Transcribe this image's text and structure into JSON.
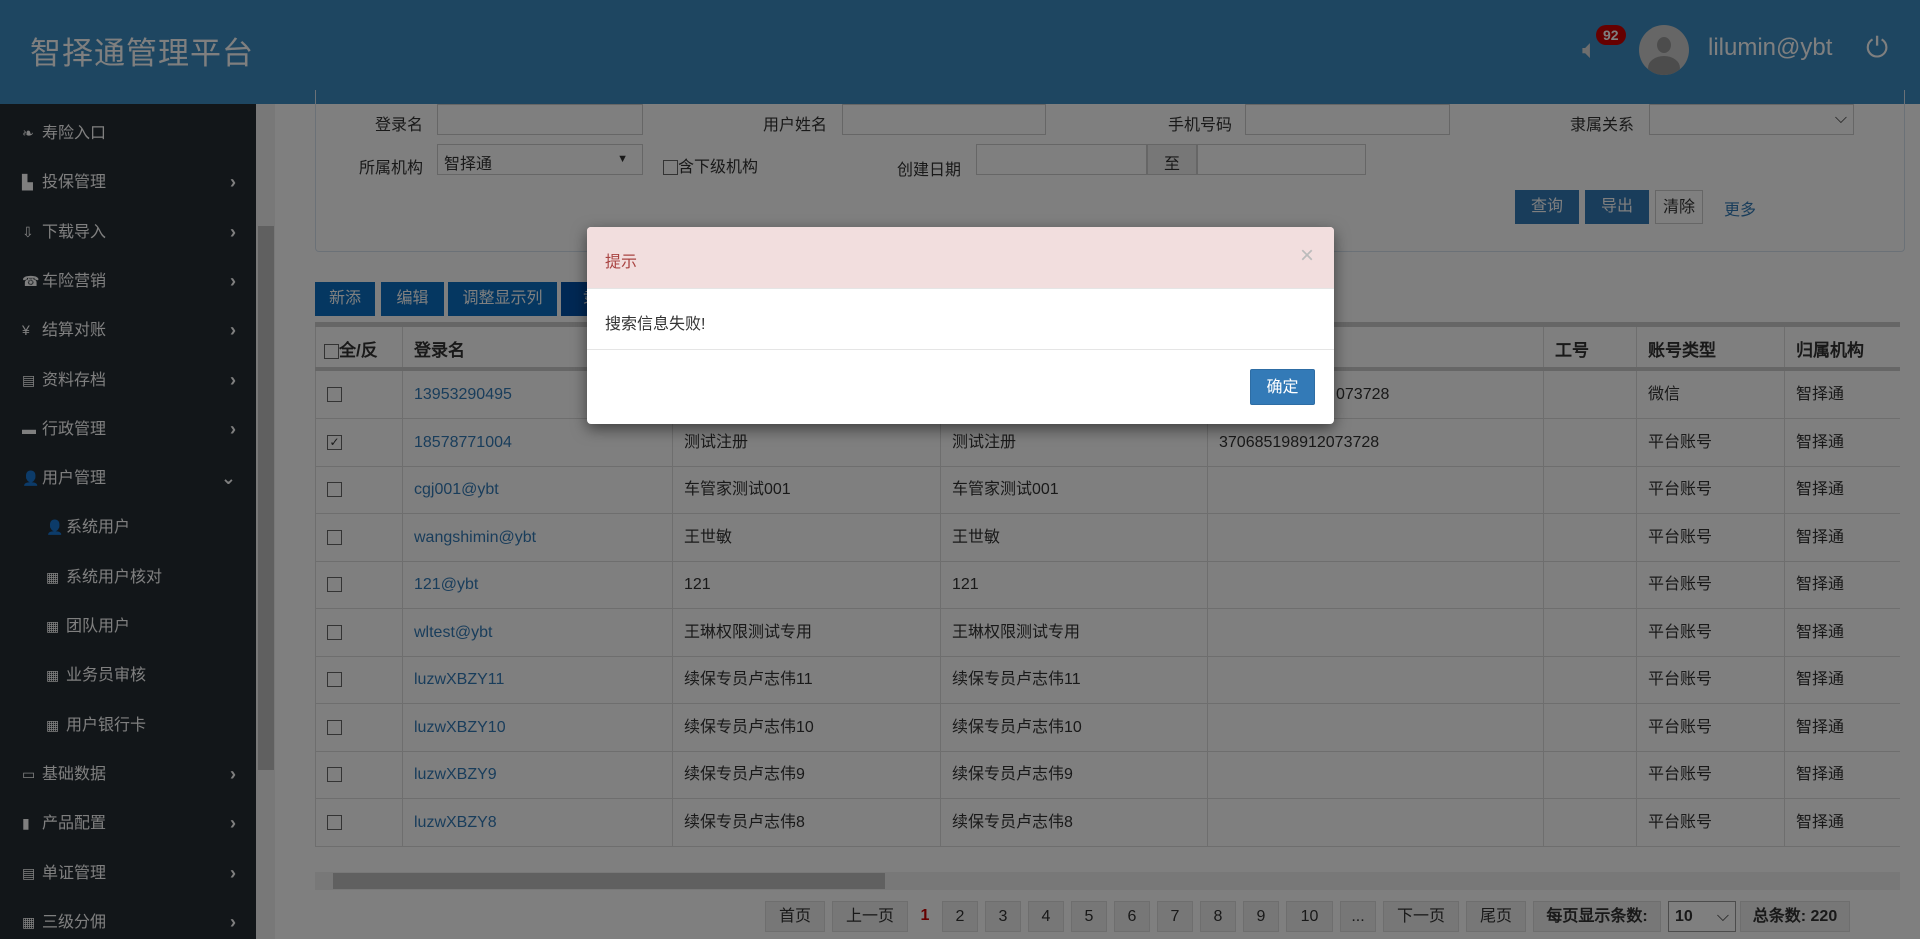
{
  "header": {
    "title": "智择通管理平台",
    "badge": "92",
    "username": "lilumin@ybt"
  },
  "sidebar": {
    "items": [
      {
        "label": "寿险入口",
        "icon": "leaf-icon",
        "glyph": "❧",
        "chevron": ""
      },
      {
        "label": "投保管理",
        "icon": "file-icon",
        "glyph": "▙",
        "chevron": "›"
      },
      {
        "label": "下载导入",
        "icon": "import-icon",
        "glyph": "⇩",
        "chevron": "›"
      },
      {
        "label": "车险营销",
        "icon": "phone-icon",
        "glyph": "☎",
        "chevron": "›"
      },
      {
        "label": "结算对账",
        "icon": "yen-icon",
        "glyph": "¥",
        "chevron": "›"
      },
      {
        "label": "资料存档",
        "icon": "list-icon",
        "glyph": "▤",
        "chevron": "›"
      },
      {
        "label": "行政管理",
        "icon": "folder-icon",
        "glyph": "▬",
        "chevron": "›"
      },
      {
        "label": "用户管理",
        "icon": "user-icon",
        "glyph": "👤",
        "chevron": "⌄"
      },
      {
        "label": "系统用户",
        "icon": "user-icon",
        "glyph": "👤",
        "chevron": "",
        "sub": true
      },
      {
        "label": "系统用户核对",
        "icon": "grid-icon",
        "glyph": "▦",
        "chevron": "",
        "sub": true
      },
      {
        "label": "团队用户",
        "icon": "grid-icon",
        "glyph": "▦",
        "chevron": "",
        "sub": true
      },
      {
        "label": "业务员审核",
        "icon": "grid-icon",
        "glyph": "▦",
        "chevron": "",
        "sub": true
      },
      {
        "label": "用户银行卡",
        "icon": "grid-icon",
        "glyph": "▦",
        "chevron": "",
        "sub": true
      },
      {
        "label": "基础数据",
        "icon": "hdd-icon",
        "glyph": "▭",
        "chevron": "›"
      },
      {
        "label": "产品配置",
        "icon": "book-icon",
        "glyph": "▮",
        "chevron": "›"
      },
      {
        "label": "单证管理",
        "icon": "list-icon",
        "glyph": "▤",
        "chevron": "›"
      },
      {
        "label": "三级分佣",
        "icon": "grid-icon",
        "glyph": "▦",
        "chevron": "›"
      }
    ]
  },
  "search": {
    "login_label": "登录名",
    "name_label": "用户姓名",
    "phone_label": "手机号码",
    "relation_label": "隶属关系",
    "org_label": "所属机构",
    "org_value": "智择通",
    "sub_org_label": "含下级机构",
    "date_label": "创建日期",
    "date_sep": "至",
    "query": "查询",
    "export": "导出",
    "clear": "清除",
    "more": "更多"
  },
  "toolbar": {
    "add": "新添",
    "edit": "编辑",
    "columns": "调整显示列",
    "fourth": "隶"
  },
  "table": {
    "headers": [
      "全/反",
      "登录名",
      "",
      "",
      "",
      "工号",
      "账号类型",
      "归属机构"
    ],
    "rows": [
      {
        "checked": false,
        "cells": [
          "13953290495",
          "",
          "",
          "073728",
          "",
          "微信",
          "智择通"
        ]
      },
      {
        "checked": true,
        "cells": [
          "18578771004",
          "测试注册",
          "测试注册",
          "370685198912073728",
          "",
          "平台账号",
          "智择通"
        ]
      },
      {
        "checked": false,
        "cells": [
          "cgj001@ybt",
          "车管家测试001",
          "车管家测试001",
          "",
          "",
          "平台账号",
          "智择通"
        ]
      },
      {
        "checked": false,
        "cells": [
          "wangshimin@ybt",
          "王世敏",
          "王世敏",
          "",
          "",
          "平台账号",
          "智择通"
        ]
      },
      {
        "checked": false,
        "cells": [
          "121@ybt",
          "121",
          "121",
          "",
          "",
          "平台账号",
          "智择通"
        ]
      },
      {
        "checked": false,
        "cells": [
          "wltest@ybt",
          "王琳权限测试专用",
          "王琳权限测试专用",
          "",
          "",
          "平台账号",
          "智择通"
        ]
      },
      {
        "checked": false,
        "cells": [
          "luzwXBZY11",
          "续保专员卢志伟11",
          "续保专员卢志伟11",
          "",
          "",
          "平台账号",
          "智择通"
        ]
      },
      {
        "checked": false,
        "cells": [
          "luzwXBZY10",
          "续保专员卢志伟10",
          "续保专员卢志伟10",
          "",
          "",
          "平台账号",
          "智择通"
        ]
      },
      {
        "checked": false,
        "cells": [
          "luzwXBZY9",
          "续保专员卢志伟9",
          "续保专员卢志伟9",
          "",
          "",
          "平台账号",
          "智择通"
        ]
      },
      {
        "checked": false,
        "cells": [
          "luzwXBZY8",
          "续保专员卢志伟8",
          "续保专员卢志伟8",
          "",
          "",
          "平台账号",
          "智择通"
        ]
      }
    ]
  },
  "pagination": {
    "first": "首页",
    "prev": "上一页",
    "current": "1",
    "pages": [
      "2",
      "3",
      "4",
      "5",
      "6",
      "7",
      "8",
      "9",
      "10",
      "..."
    ],
    "next": "下一页",
    "last": "尾页",
    "page_size_label": "每页显示条数:",
    "page_size": "10",
    "total": "总条数: 220"
  },
  "modal": {
    "title": "提示",
    "message": "搜索信息失败!",
    "ok": "确定"
  },
  "colors": {
    "header": "#3d8dc2",
    "sidebar": "#242c33",
    "primary": "#337ab7",
    "alert_bg": "#f2dede",
    "alert_text": "#a94442"
  }
}
